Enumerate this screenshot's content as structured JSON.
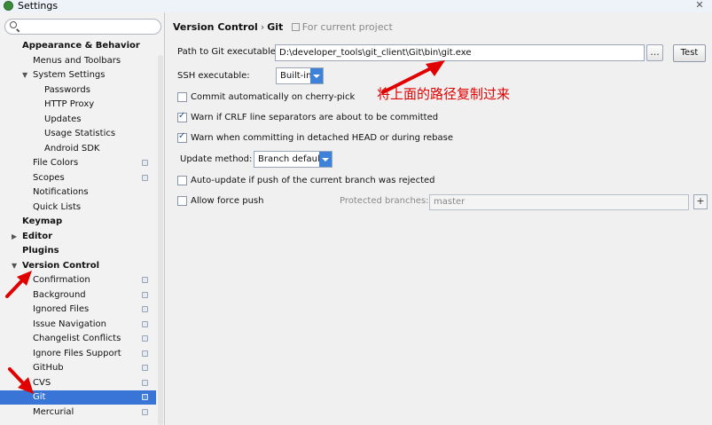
{
  "window": {
    "title": "Settings",
    "close_label": "✕"
  },
  "sidebar": {
    "search_placeholder": "",
    "items": [
      {
        "label": "Appearance & Behavior",
        "level": 0,
        "bold": true
      },
      {
        "label": "Menus and Toolbars",
        "level": 1
      },
      {
        "label": "System Settings",
        "level": 1,
        "expanded": true
      },
      {
        "label": "Passwords",
        "level": 2
      },
      {
        "label": "HTTP Proxy",
        "level": 2
      },
      {
        "label": "Updates",
        "level": 2
      },
      {
        "label": "Usage Statistics",
        "level": 2
      },
      {
        "label": "Android SDK",
        "level": 2
      },
      {
        "label": "File Colors",
        "level": 1,
        "project": true
      },
      {
        "label": "Scopes",
        "level": 1,
        "project": true
      },
      {
        "label": "Notifications",
        "level": 1
      },
      {
        "label": "Quick Lists",
        "level": 1
      },
      {
        "label": "Keymap",
        "level": 0,
        "bold": true
      },
      {
        "label": "Editor",
        "level": 0,
        "bold": true,
        "collapsed": true
      },
      {
        "label": "Plugins",
        "level": 0,
        "bold": true
      },
      {
        "label": "Version Control",
        "level": 0,
        "bold": true,
        "expanded": true
      },
      {
        "label": "Confirmation",
        "level": 1,
        "project": true
      },
      {
        "label": "Background",
        "level": 1,
        "project": true
      },
      {
        "label": "Ignored Files",
        "level": 1,
        "project": true
      },
      {
        "label": "Issue Navigation",
        "level": 1,
        "project": true
      },
      {
        "label": "Changelist Conflicts",
        "level": 1,
        "project": true
      },
      {
        "label": "Ignore Files Support",
        "level": 1,
        "project": true
      },
      {
        "label": "GitHub",
        "level": 1,
        "project": true
      },
      {
        "label": "CVS",
        "level": 1,
        "project": true
      },
      {
        "label": "Git",
        "level": 1,
        "project": true,
        "selected": true
      },
      {
        "label": "Mercurial",
        "level": 1,
        "project": true
      }
    ]
  },
  "main": {
    "breadcrumb": {
      "section": "Version Control",
      "sep": "›",
      "page": "Git",
      "note": "For current project"
    },
    "path_label": "Path to Git executable:",
    "path_value": "D:\\developer_tools\\git_client\\Git\\bin\\git.exe",
    "browse_label": "...",
    "test_label": "Test",
    "ssh_label": "SSH executable:",
    "ssh_value": "Built-in",
    "cherry_pick_label": "Commit automatically on cherry-pick",
    "crlf_label": "Warn if CRLF line separators are about to be committed",
    "detached_label": "Warn when committing in detached HEAD or during rebase",
    "update_method_label": "Update method:",
    "update_method_value": "Branch default",
    "auto_update_label": "Auto-update if push of the current branch was rejected",
    "force_push_label": "Allow force push",
    "protected_label": "Protected branches:",
    "protected_value": "master",
    "add_label": "+",
    "annotation": "将上面的路径复制过来"
  },
  "checkbox_states": {
    "cherry_pick": false,
    "crlf": true,
    "detached": true,
    "auto_update": false,
    "force_push": false
  },
  "colors": {
    "selection": "#3875d7",
    "annotation": "#e00000",
    "dropdown_accent": "#3d82d8"
  }
}
